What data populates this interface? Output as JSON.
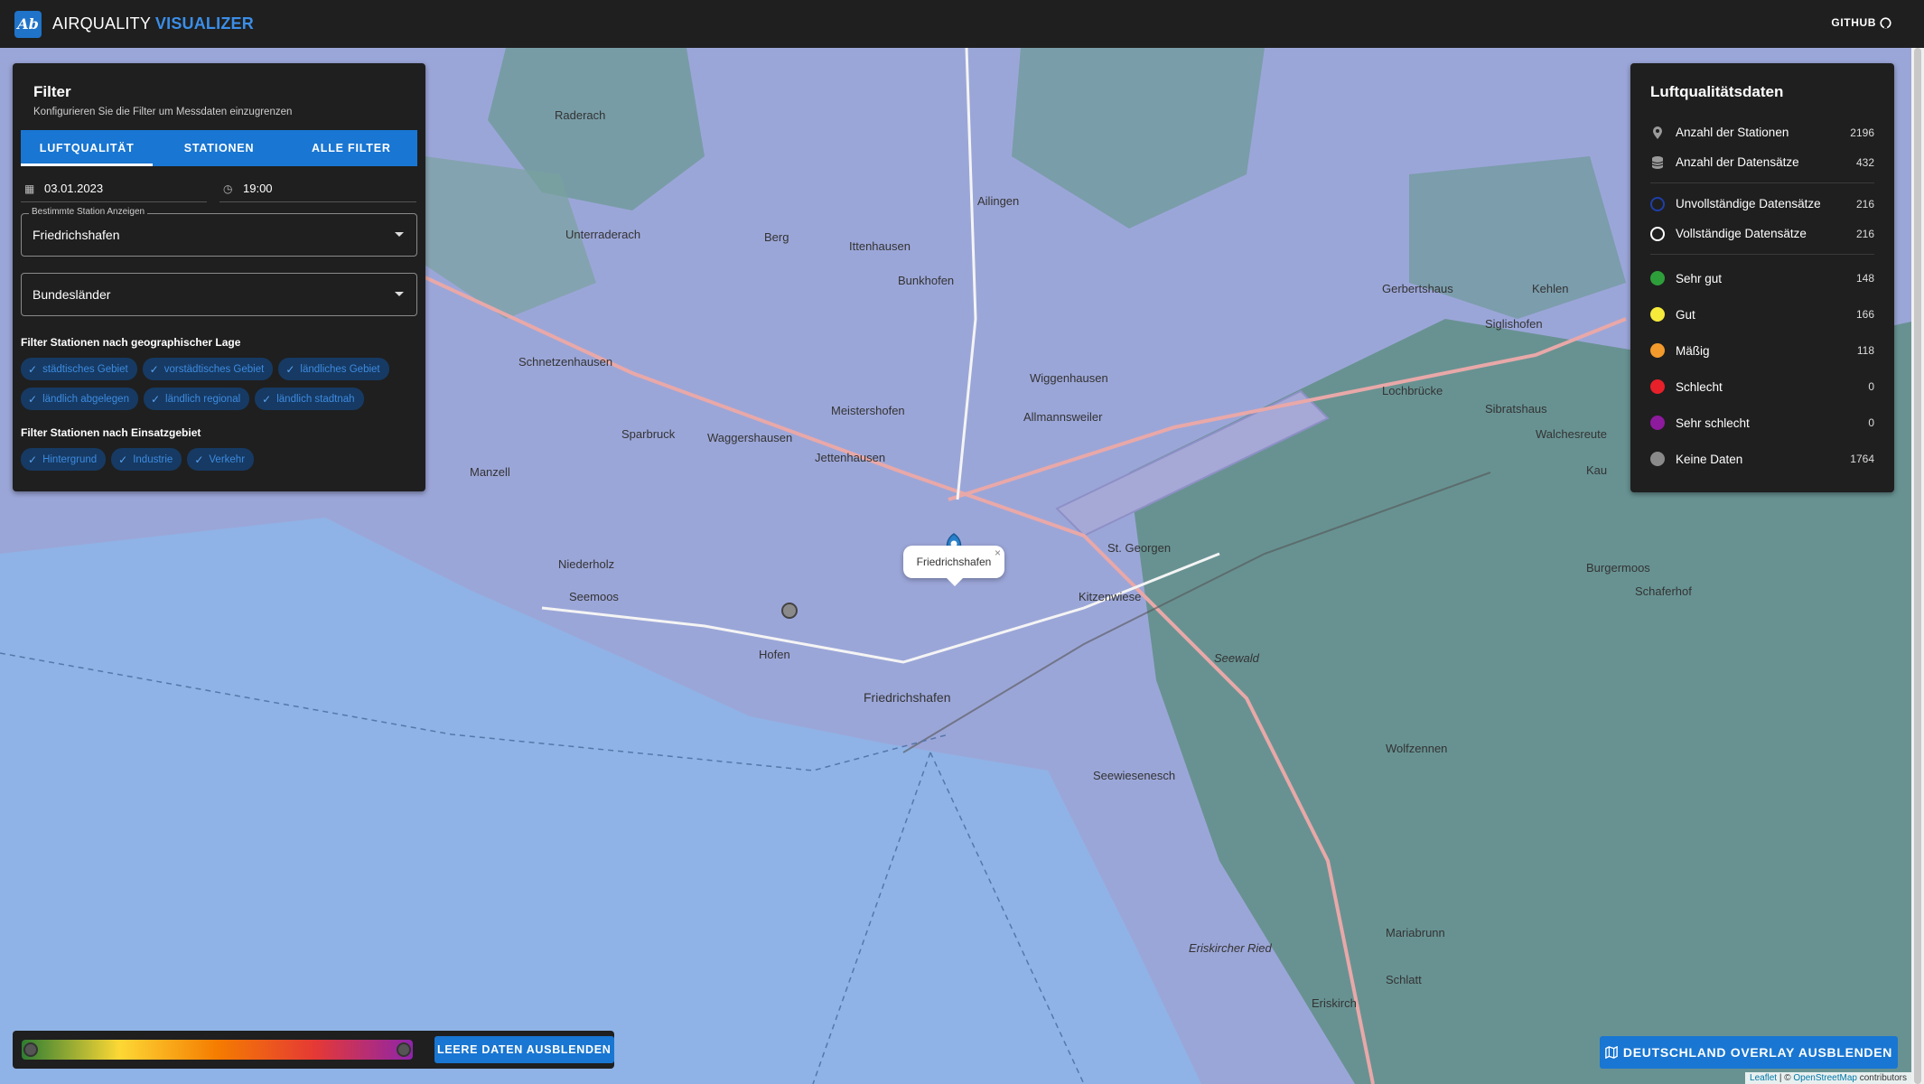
{
  "header": {
    "title_main": "AIRQUALITY",
    "title_accent": "VISUALIZER",
    "github": "GITHUB",
    "logo_text": "Ab"
  },
  "filter": {
    "title": "Filter",
    "subtitle": "Konfigurieren Sie die Filter um Messdaten einzugrenzen",
    "tabs": [
      "LUFTQUALITÄT",
      "STATIONEN",
      "ALLE FILTER"
    ],
    "date": "03.01.2023",
    "time": "19:00",
    "station_label": "Bestimmte Station Anzeigen",
    "station_value": "Friedrichshafen",
    "states_placeholder": "Bundesländer",
    "geo_label": "Filter Stationen nach geographischer Lage",
    "geo_chips": [
      "städtisches Gebiet",
      "vorstädtisches Gebiet",
      "ländliches Gebiet",
      "ländlich abgelegen",
      "ländlich regional",
      "ländlich stadtnah"
    ],
    "area_label": "Filter Stationen nach Einsatzgebiet",
    "area_chips": [
      "Hintergrund",
      "Industrie",
      "Verkehr"
    ]
  },
  "data": {
    "title": "Luftqualitätsdaten",
    "stats": [
      {
        "name": "Anzahl der Stationen",
        "value": "2196",
        "icon": "pin-icon"
      },
      {
        "name": "Anzahl der Datensätze",
        "value": "432",
        "icon": "database-icon"
      },
      {
        "name": "Unvollständige Datensätze",
        "value": "216",
        "color": "#1e3fa8"
      },
      {
        "name": "Vollständige Datensätze",
        "value": "216",
        "color": "#ffffff"
      },
      {
        "name": "Sehr gut",
        "value": "148",
        "color": "#2e9e3a"
      },
      {
        "name": "Gut",
        "value": "166",
        "color": "#f6eb3a"
      },
      {
        "name": "Mäßig",
        "value": "118",
        "color": "#f39a2c"
      },
      {
        "name": "Schlecht",
        "value": "0",
        "color": "#e8202a"
      },
      {
        "name": "Sehr schlecht",
        "value": "0",
        "color": "#8e1a9e"
      },
      {
        "name": "Keine Daten",
        "value": "1764",
        "color": "#8a8a8a"
      }
    ]
  },
  "legend": {
    "button": "LEERE DATEN AUSBLENDEN"
  },
  "overlay_button": "DEUTSCHLAND OVERLAY AUSBLENDEN",
  "map": {
    "popup": "Friedrichshafen",
    "labels": [
      "Friedrichshafen",
      "Meistershofen",
      "Waggershausen",
      "Allmannsweiler",
      "Wiggenhausen",
      "Jettenhausen",
      "Schnetzenhausen",
      "Kitzenwiese",
      "St. Georgen",
      "Seewald",
      "Eriskircher Ried",
      "Wolfzennen",
      "Seemoos",
      "Manzell",
      "Niederholz",
      "Bunkhofen",
      "Ailingen",
      "Berg",
      "Raderach",
      "Unterraderach",
      "Lochbrücke",
      "Kehlen",
      "Gerbertshaus",
      "Siglishofen",
      "Sibratshaus",
      "Walchesreute",
      "Kau",
      "Schlatt",
      "Mariabrunn",
      "Seewiesenesch",
      "Eriskirch",
      "Burgermoos",
      "Schaferhof",
      "Ittenhausen",
      "Sparbruck",
      "Hofen"
    ],
    "attribution_leaflet": "Leaflet",
    "attribution_osm": "OpenStreetMap",
    "attribution_rest": " | © ",
    "attribution_tail": " contributors"
  }
}
